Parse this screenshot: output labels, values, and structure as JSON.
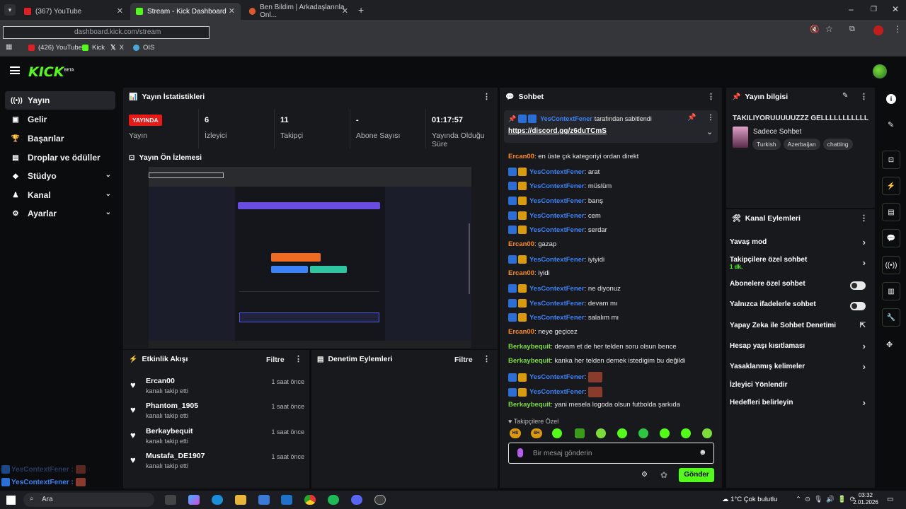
{
  "browser": {
    "tabs": [
      {
        "title": "(367) YouTube",
        "color": "#e02020"
      },
      {
        "title": "Stream - Kick Dashboard",
        "color": "#53fc18"
      },
      {
        "title": "Ben Bildim | Arkadaşlarınla Onl...",
        "color": "#e0582a"
      }
    ],
    "url": "dashboard.kick.com/stream",
    "bookmarks": [
      {
        "label": "(426) YouTube",
        "color": "#e02020"
      },
      {
        "label": "Kick",
        "color": "#53fc18"
      },
      {
        "label": "X",
        "color": "#e8e8e8"
      },
      {
        "label": "OIS",
        "color": "#4aa8d8"
      }
    ]
  },
  "app": {
    "logo": "KICK",
    "logo_tag": "BETA"
  },
  "sidebar": {
    "items": [
      {
        "label": "Yayın",
        "icon": "broadcast-icon"
      },
      {
        "label": "Gelir",
        "icon": "wallet-icon"
      },
      {
        "label": "Başarılar",
        "icon": "trophy-icon"
      },
      {
        "label": "Droplar ve ödüller",
        "icon": "gift-icon"
      },
      {
        "label": "Stüdyo",
        "icon": "studio-icon"
      },
      {
        "label": "Kanal",
        "icon": "channel-icon"
      },
      {
        "label": "Ayarlar",
        "icon": "gear-icon"
      }
    ]
  },
  "stats": {
    "title": "Yayın İstatistikleri",
    "live_label": "YAYINDA",
    "live_sub": "Yayın",
    "items": [
      {
        "value": "6",
        "label": "İzleyici"
      },
      {
        "value": "11",
        "label": "Takipçi"
      },
      {
        "value": "-",
        "label": "Abone Sayısı"
      },
      {
        "value": "01:17:57",
        "label": "Yayında Olduğu Süre"
      }
    ]
  },
  "preview": {
    "title": "Yayın Ön İzlemesi"
  },
  "activity": {
    "title": "Etkinlik Akışı",
    "filter": "Filtre",
    "items": [
      {
        "name": "Ercan00",
        "action": "kanalı takip etti",
        "time": "1 saat önce"
      },
      {
        "name": "Phantom_1905",
        "action": "kanalı takip etti",
        "time": "1 saat önce"
      },
      {
        "name": "Berkaybequit",
        "action": "kanalı takip etti",
        "time": "1 saat önce"
      },
      {
        "name": "Mustafa_DE1907",
        "action": "kanalı takip etti",
        "time": "1 saat önce"
      }
    ]
  },
  "moderation": {
    "title": "Denetim Eylemleri",
    "filter": "Filtre"
  },
  "chat": {
    "title": "Sohbet",
    "pinned_by": "YesContextFener",
    "pinned_suffix": "tarafından sabitlendi",
    "pinned_link": "https://discord.gg/z6duTCmS",
    "messages": [
      {
        "user": "Ercan00",
        "text": ": en üste çık kategoriyi ordan direkt",
        "kind": "o"
      },
      {
        "user": "YesContextFener",
        "text": ": arat",
        "kind": "b"
      },
      {
        "user": "YesContextFener",
        "text": ": müslüm",
        "kind": "b"
      },
      {
        "user": "YesContextFener",
        "text": ": barış",
        "kind": "b"
      },
      {
        "user": "YesContextFener",
        "text": ": cem",
        "kind": "b"
      },
      {
        "user": "YesContextFener",
        "text": ": serdar",
        "kind": "b"
      },
      {
        "user": "Ercan00",
        "text": ": gazap",
        "kind": "o"
      },
      {
        "user": "YesContextFener",
        "text": ": iyiyidi",
        "kind": "b"
      },
      {
        "user": "Ercan00",
        "text": ": iyidi",
        "kind": "o"
      },
      {
        "user": "YesContextFener",
        "text": ": ne diyonuz",
        "kind": "b"
      },
      {
        "user": "YesContextFener",
        "text": ": devam mı",
        "kind": "b"
      },
      {
        "user": "YesContextFener",
        "text": ": salalım mı",
        "kind": "b"
      },
      {
        "user": "Ercan00",
        "text": ": neye geçicez",
        "kind": "o"
      },
      {
        "user": "Berkaybequit",
        "text": ": devam et de her telden soru olsun bence",
        "kind": "g"
      },
      {
        "user": "Berkaybequit",
        "text": ": kanka her telden demek istedigim bu değildi",
        "kind": "g"
      },
      {
        "user": "YesContextFener",
        "text": ":",
        "kind": "b",
        "emote": true
      },
      {
        "user": "YesContextFener",
        "text": ":",
        "kind": "b",
        "emote": true
      },
      {
        "user": "Berkaybequit",
        "text": ": yani mesela logoda olsun futbolda şarkıda",
        "kind": "g"
      }
    ],
    "followers_only": "Takipçilere Özel",
    "emotes": [
      "HS",
      "SH"
    ],
    "placeholder": "Bir mesaj gönderin",
    "send": "Gönder"
  },
  "info": {
    "title": "Yayın bilgisi",
    "stream_title": "TAKILIYORUUUUUZZZ GELLLLLLLLLLL",
    "category": "Sadece Sohbet",
    "tags": [
      "Turkish",
      "Azerbaijan",
      "chatting"
    ]
  },
  "channel_actions": {
    "title": "Kanal Eylemleri",
    "items": [
      {
        "label": "Yavaş mod",
        "type": "arrow"
      },
      {
        "label": "Takipçilere özel sohbet",
        "sub": "1 dk.",
        "type": "arrow"
      },
      {
        "label": "Abonelere özel sohbet",
        "type": "toggle"
      },
      {
        "label": "Yalnızca ifadelerle sohbet",
        "type": "toggle"
      },
      {
        "label": "Yapay Zeka ile Sohbet Denetimi",
        "type": "external"
      },
      {
        "label": "Hesap yaşı kısıtlaması",
        "type": "arrow"
      },
      {
        "label": "Yasaklanmış kelimeler",
        "type": "arrow"
      },
      {
        "label": "İzleyici Yönlendir",
        "type": "none"
      },
      {
        "label": "Hedefleri belirleyin",
        "type": "arrow"
      }
    ]
  },
  "overlay": {
    "line1": "YesContextFener :",
    "line2": "YesContextFener :"
  },
  "taskbar": {
    "search": "Ara",
    "weather": "1°C  Çok bulutlu",
    "time": "03:32",
    "date": "2.01.2026"
  }
}
